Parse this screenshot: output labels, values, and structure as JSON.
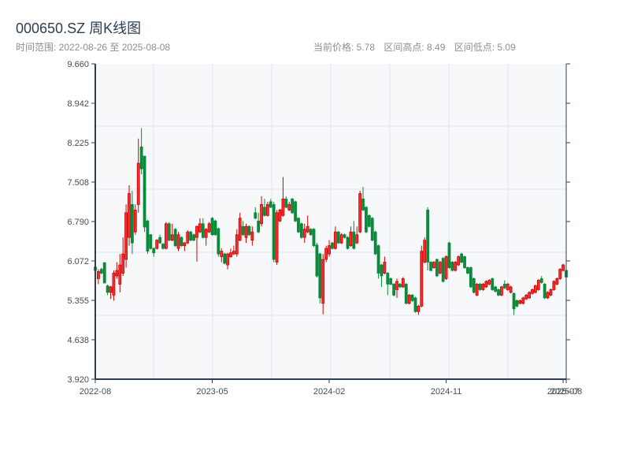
{
  "header": {
    "title": "000650.SZ 周K线图",
    "range_text": "时间范围: 2022-08-26 至 2025-08-08",
    "current_price": "当前价格: 5.78",
    "range_high": "区间高点: 8.49",
    "range_low": "区间低点: 5.09"
  },
  "colors": {
    "up": "#d40000",
    "up_fill": "#ee3030",
    "down": "#0a8a3a",
    "axis": "#2c3e50",
    "plot_bg": "#f6f8fa",
    "grid": "#e1e5ea"
  },
  "chart_data": {
    "type": "candlestick",
    "title": "000650.SZ 周K线图",
    "ylim": [
      3.92,
      9.66
    ],
    "yticks": [
      "3.920",
      "4.638",
      "5.355",
      "6.072",
      "6.790",
      "7.508",
      "8.225",
      "8.942",
      "9.660"
    ],
    "xticks": [
      {
        "label": "2022-08",
        "index": 0
      },
      {
        "label": "2023-05",
        "index": 38
      },
      {
        "label": "2024-02",
        "index": 76
      },
      {
        "label": "2024-11",
        "index": 114
      },
      {
        "label": "2025-07",
        "index": 152
      },
      {
        "label": "2025-08",
        "index": 153
      }
    ],
    "ohlc_order": [
      "open",
      "high",
      "low",
      "close"
    ],
    "candles": [
      [
        5.96,
        5.98,
        5.88,
        5.9
      ],
      [
        5.75,
        5.92,
        5.65,
        5.88
      ],
      [
        5.92,
        5.95,
        5.83,
        5.85
      ],
      [
        6.04,
        6.05,
        5.67,
        5.67
      ],
      [
        5.62,
        5.64,
        5.45,
        5.5
      ],
      [
        5.5,
        5.62,
        5.38,
        5.6
      ],
      [
        5.45,
        5.9,
        5.35,
        5.85
      ],
      [
        5.8,
        6.05,
        5.75,
        5.9
      ],
      [
        5.65,
        6.2,
        5.5,
        6.0
      ],
      [
        5.85,
        6.5,
        5.8,
        6.2
      ],
      [
        6.1,
        7.1,
        5.95,
        6.95
      ],
      [
        6.5,
        7.45,
        6.35,
        7.3
      ],
      [
        7.1,
        7.35,
        6.2,
        6.4
      ],
      [
        6.6,
        7.1,
        6.55,
        7.0
      ],
      [
        7.1,
        8.3,
        6.95,
        7.85
      ],
      [
        8.15,
        8.49,
        7.65,
        7.75
      ],
      [
        7.98,
        7.98,
        6.6,
        6.69
      ],
      [
        6.8,
        6.82,
        6.2,
        6.25
      ],
      [
        6.55,
        6.56,
        6.28,
        6.3
      ],
      [
        6.3,
        6.32,
        6.15,
        6.22
      ],
      [
        6.3,
        6.47,
        6.28,
        6.45
      ],
      [
        6.5,
        6.55,
        6.38,
        6.4
      ],
      [
        6.38,
        6.4,
        6.28,
        6.3
      ],
      [
        6.3,
        6.78,
        6.28,
        6.75
      ],
      [
        6.75,
        6.78,
        6.43,
        6.45
      ],
      [
        6.45,
        6.75,
        6.43,
        6.55
      ],
      [
        6.65,
        6.67,
        6.33,
        6.35
      ],
      [
        6.3,
        6.6,
        6.25,
        6.55
      ],
      [
        6.5,
        6.52,
        6.33,
        6.35
      ],
      [
        6.35,
        6.42,
        6.25,
        6.4
      ],
      [
        6.4,
        6.63,
        6.38,
        6.6
      ],
      [
        6.6,
        6.62,
        6.43,
        6.45
      ],
      [
        6.55,
        6.57,
        6.43,
        6.45
      ],
      [
        6.5,
        6.72,
        6.06,
        6.7
      ],
      [
        6.6,
        6.85,
        6.58,
        6.75
      ],
      [
        6.75,
        6.85,
        6.48,
        6.5
      ],
      [
        6.5,
        6.67,
        6.35,
        6.65
      ],
      [
        6.6,
        6.78,
        6.58,
        6.75
      ],
      [
        6.85,
        6.87,
        6.53,
        6.55
      ],
      [
        6.8,
        6.82,
        6.53,
        6.55
      ],
      [
        6.66,
        6.68,
        6.15,
        6.2
      ],
      [
        6.15,
        6.3,
        6.05,
        6.25
      ],
      [
        6.2,
        6.22,
        6.01,
        6.03
      ],
      [
        6.0,
        6.22,
        5.92,
        6.2
      ],
      [
        6.15,
        6.3,
        6.13,
        6.22
      ],
      [
        6.2,
        6.35,
        6.18,
        6.25
      ],
      [
        6.2,
        6.65,
        6.15,
        6.55
      ],
      [
        6.45,
        6.95,
        6.43,
        6.85
      ],
      [
        6.7,
        6.8,
        6.53,
        6.55
      ],
      [
        6.5,
        6.75,
        6.4,
        6.7
      ],
      [
        6.7,
        6.72,
        6.53,
        6.55
      ],
      [
        6.45,
        6.7,
        6.35,
        6.6
      ],
      [
        6.95,
        7.05,
        6.83,
        6.85
      ],
      [
        6.8,
        6.95,
        6.58,
        6.6
      ],
      [
        6.75,
        7.25,
        6.7,
        7.1
      ],
      [
        7.05,
        7.2,
        6.88,
        6.9
      ],
      [
        6.9,
        7.15,
        6.88,
        7.1
      ],
      [
        7.15,
        7.2,
        7.03,
        7.05
      ],
      [
        7.1,
        7.15,
        6.05,
        6.1
      ],
      [
        6.05,
        7.0,
        6.0,
        6.95
      ],
      [
        6.8,
        7.02,
        6.78,
        7.0
      ],
      [
        6.9,
        7.6,
        6.88,
        7.2
      ],
      [
        7.2,
        7.25,
        7.03,
        7.05
      ],
      [
        7.0,
        7.15,
        6.98,
        7.1
      ],
      [
        7.2,
        7.22,
        6.93,
        6.95
      ],
      [
        7.15,
        7.17,
        6.78,
        6.8
      ],
      [
        6.85,
        6.87,
        6.58,
        6.6
      ],
      [
        6.75,
        6.77,
        6.48,
        6.5
      ],
      [
        6.5,
        6.75,
        6.4,
        6.65
      ],
      [
        6.6,
        6.9,
        6.58,
        6.7
      ],
      [
        6.65,
        6.67,
        6.53,
        6.55
      ],
      [
        6.65,
        6.67,
        6.33,
        6.35
      ],
      [
        6.36,
        6.4,
        5.77,
        5.8
      ],
      [
        6.2,
        6.22,
        5.3,
        5.4
      ],
      [
        5.3,
        6.2,
        5.1,
        6.1
      ],
      [
        6.1,
        6.35,
        6.05,
        6.3
      ],
      [
        6.2,
        6.45,
        6.15,
        6.35
      ],
      [
        6.4,
        6.42,
        6.28,
        6.3
      ],
      [
        6.3,
        6.7,
        6.28,
        6.6
      ],
      [
        6.6,
        6.62,
        6.38,
        6.4
      ],
      [
        6.4,
        6.58,
        6.38,
        6.55
      ],
      [
        6.55,
        6.57,
        6.48,
        6.5
      ],
      [
        6.5,
        6.52,
        6.28,
        6.3
      ],
      [
        6.35,
        6.7,
        6.33,
        6.6
      ],
      [
        6.6,
        6.8,
        6.28,
        6.3
      ],
      [
        6.4,
        6.7,
        6.38,
        6.55
      ],
      [
        6.6,
        7.35,
        6.58,
        7.3
      ],
      [
        7.2,
        7.42,
        6.98,
        7.0
      ],
      [
        7.05,
        7.07,
        6.58,
        6.6
      ],
      [
        6.9,
        6.92,
        6.68,
        6.7
      ],
      [
        6.85,
        6.87,
        6.43,
        6.45
      ],
      [
        6.6,
        6.62,
        6.18,
        6.2
      ],
      [
        6.35,
        6.37,
        5.75,
        5.85
      ],
      [
        6.0,
        6.02,
        5.6,
        5.8
      ],
      [
        5.85,
        6.15,
        5.83,
        6.05
      ],
      [
        5.85,
        5.87,
        5.45,
        5.65
      ],
      [
        5.75,
        5.77,
        5.63,
        5.65
      ],
      [
        5.65,
        5.67,
        5.43,
        5.45
      ],
      [
        5.55,
        5.75,
        5.4,
        5.7
      ],
      [
        5.65,
        5.67,
        5.58,
        5.6
      ],
      [
        5.6,
        5.78,
        5.58,
        5.75
      ],
      [
        5.65,
        5.67,
        5.28,
        5.3
      ],
      [
        5.3,
        5.47,
        5.28,
        5.45
      ],
      [
        5.45,
        5.47,
        5.33,
        5.35
      ],
      [
        5.4,
        5.42,
        5.13,
        5.15
      ],
      [
        5.15,
        5.27,
        5.09,
        5.25
      ],
      [
        5.25,
        6.35,
        5.23,
        6.25
      ],
      [
        6.05,
        6.5,
        6.03,
        6.45
      ],
      [
        7.0,
        7.05,
        5.9,
        6.05
      ],
      [
        6.05,
        6.07,
        5.88,
        5.9
      ],
      [
        5.95,
        6.07,
        5.93,
        6.05
      ],
      [
        6.1,
        6.12,
        5.78,
        5.8
      ],
      [
        5.85,
        6.07,
        5.83,
        6.05
      ],
      [
        6.12,
        6.14,
        5.68,
        5.7
      ],
      [
        5.75,
        6.17,
        5.73,
        6.15
      ],
      [
        6.4,
        6.42,
        5.93,
        5.95
      ],
      [
        6.05,
        6.07,
        5.88,
        5.9
      ],
      [
        5.9,
        6.07,
        5.88,
        6.05
      ],
      [
        6.0,
        6.17,
        5.98,
        6.15
      ],
      [
        6.2,
        6.22,
        6.03,
        6.05
      ],
      [
        6.15,
        6.17,
        5.93,
        5.95
      ],
      [
        5.95,
        5.97,
        5.83,
        5.85
      ],
      [
        5.95,
        5.97,
        5.58,
        5.6
      ],
      [
        5.75,
        5.77,
        5.48,
        5.5
      ],
      [
        5.45,
        5.67,
        5.43,
        5.65
      ],
      [
        5.65,
        5.67,
        5.53,
        5.55
      ],
      [
        5.55,
        5.67,
        5.53,
        5.65
      ],
      [
        5.6,
        5.72,
        5.58,
        5.7
      ],
      [
        5.65,
        5.74,
        5.63,
        5.72
      ],
      [
        5.75,
        5.77,
        5.53,
        5.55
      ],
      [
        5.6,
        5.62,
        5.5,
        5.52
      ],
      [
        5.55,
        5.57,
        5.43,
        5.45
      ],
      [
        5.45,
        5.62,
        5.43,
        5.6
      ],
      [
        5.65,
        5.72,
        5.56,
        5.58
      ],
      [
        5.55,
        5.67,
        5.53,
        5.65
      ],
      [
        5.5,
        5.62,
        5.48,
        5.6
      ],
      [
        5.48,
        5.5,
        5.09,
        5.2
      ],
      [
        5.35,
        5.37,
        5.23,
        5.25
      ],
      [
        5.3,
        5.37,
        5.28,
        5.35
      ],
      [
        5.3,
        5.42,
        5.28,
        5.4
      ],
      [
        5.38,
        5.47,
        5.36,
        5.45
      ],
      [
        5.4,
        5.52,
        5.38,
        5.5
      ],
      [
        5.48,
        5.57,
        5.46,
        5.55
      ],
      [
        5.5,
        5.64,
        5.48,
        5.62
      ],
      [
        5.55,
        5.74,
        5.53,
        5.72
      ],
      [
        5.75,
        5.8,
        5.66,
        5.68
      ],
      [
        5.65,
        5.67,
        5.38,
        5.4
      ],
      [
        5.4,
        5.52,
        5.38,
        5.5
      ],
      [
        5.45,
        5.57,
        5.43,
        5.55
      ],
      [
        5.55,
        5.72,
        5.53,
        5.7
      ],
      [
        5.65,
        5.77,
        5.63,
        5.75
      ],
      [
        5.75,
        5.94,
        5.73,
        5.92
      ],
      [
        5.9,
        6.02,
        5.88,
        6.0
      ],
      [
        5.9,
        5.95,
        5.76,
        5.78
      ]
    ]
  }
}
